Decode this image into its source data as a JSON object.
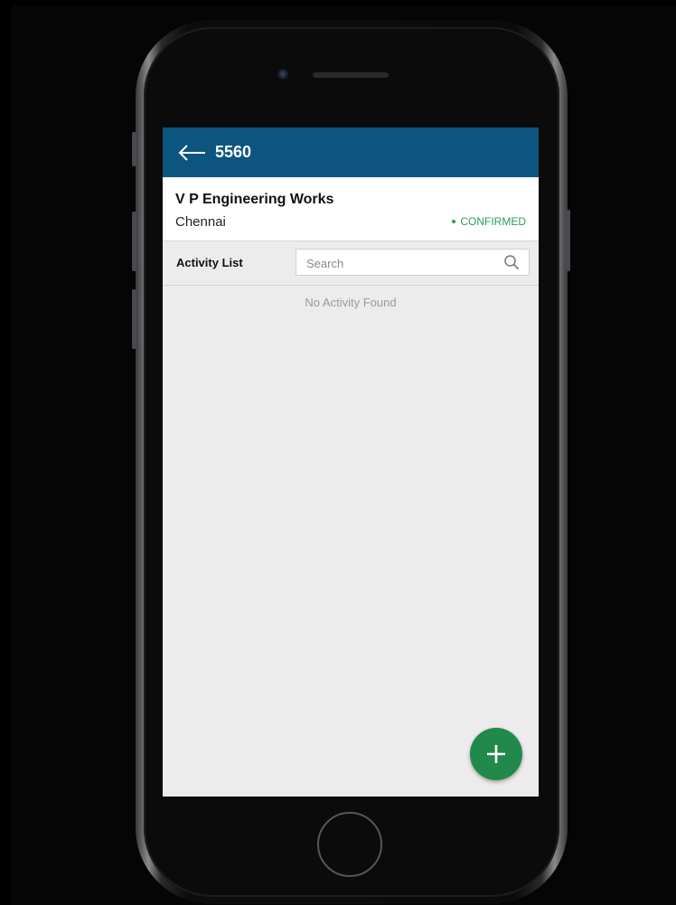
{
  "header": {
    "title": "5560",
    "back_icon": "arrow-left-icon",
    "bar_color": "#0b5580"
  },
  "customer": {
    "name": "V P Engineering Works",
    "city": "Chennai",
    "status": "CONFIRMED",
    "status_color": "#2e9b57"
  },
  "activity": {
    "label": "Activity List",
    "search_placeholder": "Search",
    "search_icon": "search-icon",
    "empty_message": "No Activity Found"
  },
  "fab": {
    "icon": "plus-icon",
    "color": "#22894c"
  }
}
